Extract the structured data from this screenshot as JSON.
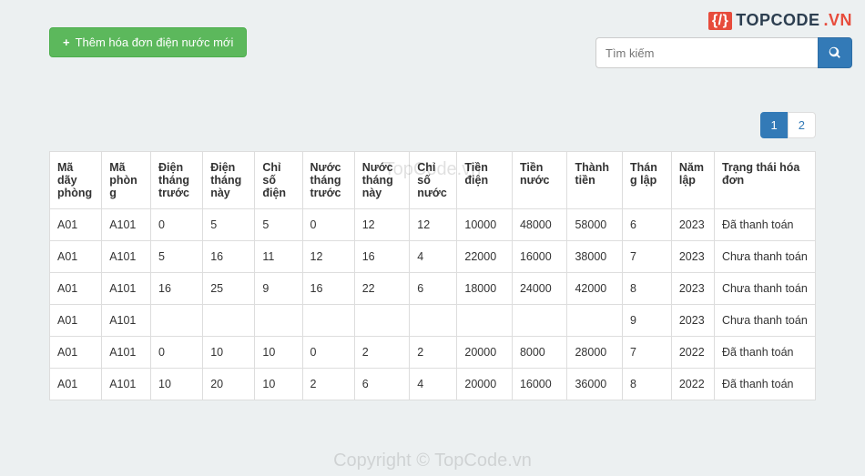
{
  "logo": {
    "brace": "{/}",
    "text": "TOPCODE",
    "suffix": ".VN"
  },
  "add_button": "Thêm hóa đơn điện nước mới",
  "search": {
    "placeholder": "Tìm kiếm"
  },
  "pagination": {
    "page1": "1",
    "page2": "2"
  },
  "watermark1": "TopCode.vn",
  "watermark2": "Copyright © TopCode.vn",
  "headers": {
    "c0": "Mã dãy phòng",
    "c1": "Mã phòng",
    "c2": "Điện tháng trước",
    "c3": "Điện tháng này",
    "c4": "Chỉ số điện",
    "c5": "Nước tháng trước",
    "c6": "Nước tháng này",
    "c7": "Chỉ số nước",
    "c8": "Tiền điện",
    "c9": "Tiền nước",
    "c10": "Thành tiền",
    "c11": "Tháng lập",
    "c12": "Năm lập",
    "c13": "Trạng thái hóa đơn"
  },
  "rows": [
    {
      "c0": "A01",
      "c1": "A101",
      "c2": "0",
      "c3": "5",
      "c4": "5",
      "c5": "0",
      "c6": "12",
      "c7": "12",
      "c8": "10000",
      "c9": "48000",
      "c10": "58000",
      "c11": "6",
      "c12": "2023",
      "c13": "Đã thanh toán"
    },
    {
      "c0": "A01",
      "c1": "A101",
      "c2": "5",
      "c3": "16",
      "c4": "11",
      "c5": "12",
      "c6": "16",
      "c7": "4",
      "c8": "22000",
      "c9": "16000",
      "c10": "38000",
      "c11": "7",
      "c12": "2023",
      "c13": "Chưa thanh toán"
    },
    {
      "c0": "A01",
      "c1": "A101",
      "c2": "16",
      "c3": "25",
      "c4": "9",
      "c5": "16",
      "c6": "22",
      "c7": "6",
      "c8": "18000",
      "c9": "24000",
      "c10": "42000",
      "c11": "8",
      "c12": "2023",
      "c13": "Chưa thanh toán"
    },
    {
      "c0": "A01",
      "c1": "A101",
      "c2": "",
      "c3": "",
      "c4": "",
      "c5": "",
      "c6": "",
      "c7": "",
      "c8": "",
      "c9": "",
      "c10": "",
      "c11": "9",
      "c12": "2023",
      "c13": "Chưa thanh toán"
    },
    {
      "c0": "A01",
      "c1": "A101",
      "c2": "0",
      "c3": "10",
      "c4": "10",
      "c5": "0",
      "c6": "2",
      "c7": "2",
      "c8": "20000",
      "c9": "8000",
      "c10": "28000",
      "c11": "7",
      "c12": "2022",
      "c13": "Đã thanh toán"
    },
    {
      "c0": "A01",
      "c1": "A101",
      "c2": "10",
      "c3": "20",
      "c4": "10",
      "c5": "2",
      "c6": "6",
      "c7": "4",
      "c8": "20000",
      "c9": "16000",
      "c10": "36000",
      "c11": "8",
      "c12": "2022",
      "c13": "Đã thanh toán"
    }
  ]
}
